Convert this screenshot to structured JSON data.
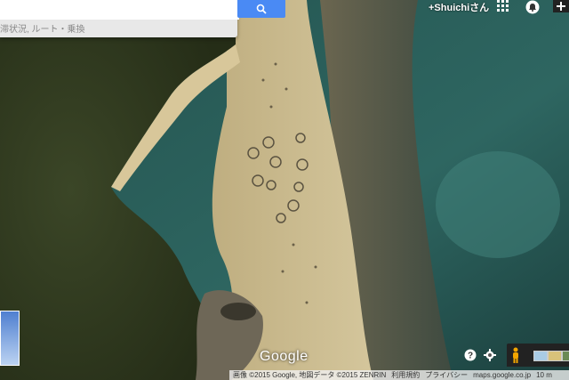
{
  "search": {
    "placeholder": "",
    "sub_text": "滞状況, ルート・乗換"
  },
  "header": {
    "user_name": "+Shuichiさん"
  },
  "watermark": "Google",
  "attribution": {
    "imagery": "画像 ©2015 Google, 地図データ ©2015 ZENRIN",
    "terms": "利用規約",
    "privacy": "プライバシー",
    "domain": "maps.google.co.jp",
    "scale": "10 m"
  },
  "icons": [
    "search-icon",
    "apps-grid-icon",
    "notification-bell-icon",
    "plus-icon",
    "help-icon",
    "gear-icon",
    "pegman-icon"
  ],
  "colors": {
    "search_button": "#4a8af4",
    "pegman": "#f3a600",
    "ocean": "#1c4a47",
    "sand": "#c9b98c",
    "vegetation": "#2f3a1e"
  }
}
